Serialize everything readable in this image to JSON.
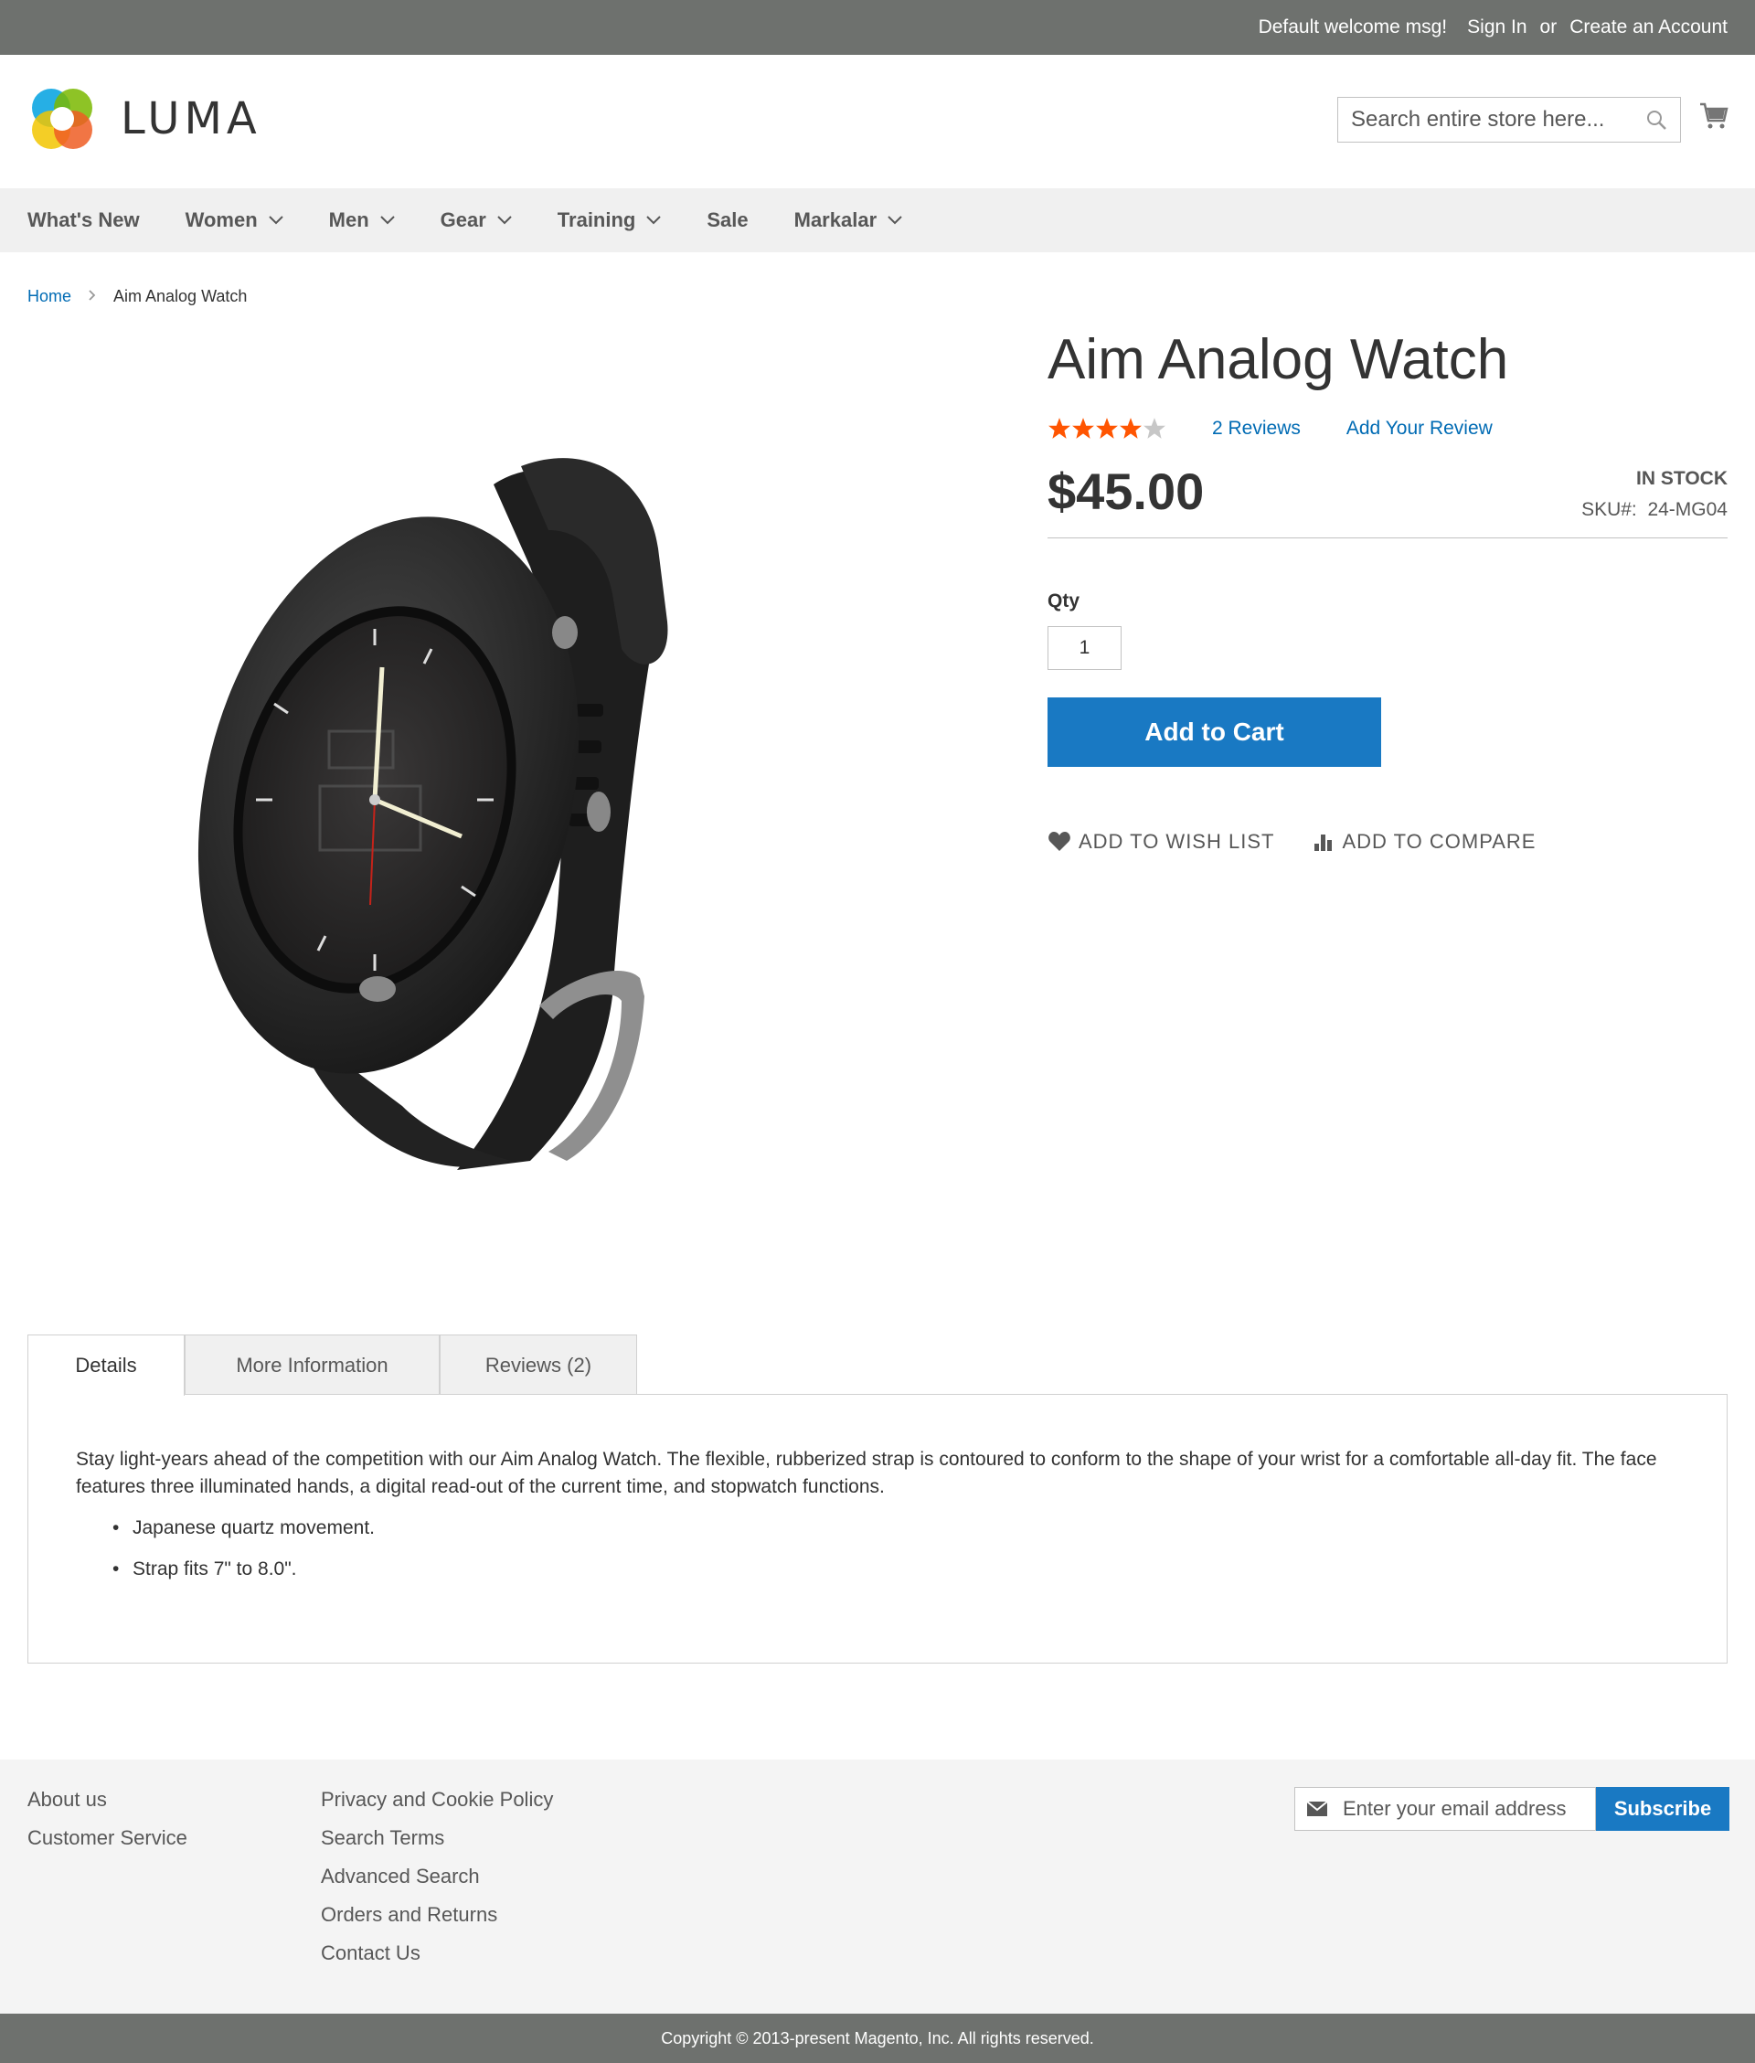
{
  "top_panel": {
    "welcome": "Default welcome msg!",
    "sign_in": "Sign In",
    "or": "or",
    "create_account": "Create an Account"
  },
  "header": {
    "logo_text": "LUMA",
    "search_placeholder": "Search entire store here..."
  },
  "nav": {
    "items": [
      {
        "label": "What's New",
        "has_dropdown": false
      },
      {
        "label": "Women",
        "has_dropdown": true
      },
      {
        "label": "Men",
        "has_dropdown": true
      },
      {
        "label": "Gear",
        "has_dropdown": true
      },
      {
        "label": "Training",
        "has_dropdown": true
      },
      {
        "label": "Sale",
        "has_dropdown": false
      },
      {
        "label": "Markalar",
        "has_dropdown": true
      }
    ]
  },
  "breadcrumb": {
    "home": "Home",
    "current": "Aim Analog Watch"
  },
  "product": {
    "title": "Aim Analog Watch",
    "rating_stars": 4,
    "rating_max": 5,
    "reviews_link": "2  Reviews",
    "add_review": "Add Your Review",
    "price": "$45.00",
    "stock": "IN STOCK",
    "sku_label": "SKU#:",
    "sku": "24-MG04",
    "qty_label": "Qty",
    "qty_value": "1",
    "add_to_cart": "Add to Cart",
    "add_to_wishlist": "ADD TO WISH LIST",
    "add_to_compare": "ADD TO COMPARE"
  },
  "tabs": {
    "items": [
      "Details",
      "More Information",
      "Reviews (2)"
    ],
    "active": "Details",
    "details": {
      "description": "Stay light-years ahead of the competition with our Aim Analog Watch. The flexible, rubberized strap is contoured to conform to the shape of your wrist for a comfortable all-day fit. The face features three illuminated hands, a digital read-out of the current time, and stopwatch functions.",
      "bullets": [
        "Japanese quartz movement.",
        "Strap fits 7\" to 8.0\"."
      ]
    }
  },
  "footer": {
    "col1": [
      "About us",
      "Customer Service"
    ],
    "col2": [
      "Privacy and Cookie Policy",
      "Search Terms",
      "Advanced Search",
      "Orders and Returns",
      "Contact Us"
    ],
    "newsletter_placeholder": "Enter your email address",
    "subscribe": "Subscribe",
    "copyright": "Copyright © 2013-present Magento, Inc. All rights reserved."
  },
  "colors": {
    "link": "#006bb4",
    "primary_button": "#1979c3",
    "star_on": "#ff5501",
    "star_off": "#c7c7c7",
    "top_bar": "#6e716e"
  }
}
